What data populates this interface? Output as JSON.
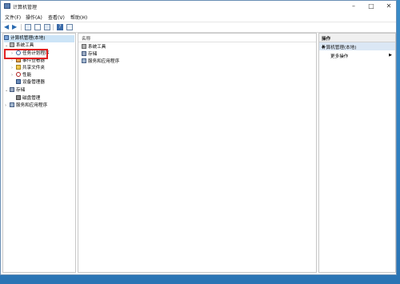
{
  "window": {
    "title": "计算机管理"
  },
  "menubar": [
    "文件(F)",
    "操作(A)",
    "查看(V)",
    "帮助(H)"
  ],
  "tree": {
    "root": "计算机管理(本地)",
    "system_tools": "系统工具",
    "task_scheduler": "任务计划程序",
    "event_viewer": "事件查看器",
    "shared_folders": "共享文件夹",
    "performance": "性能",
    "device_manager": "设备管理器",
    "storage": "存储",
    "disk_management": "磁盘管理",
    "services_apps": "服务和应用程序"
  },
  "main": {
    "column_name": "名称",
    "items": [
      "系统工具",
      "存储",
      "服务和应用程序"
    ]
  },
  "actions": {
    "header": "操作",
    "section": "计算机管理(本地)",
    "more": "更多操作"
  }
}
